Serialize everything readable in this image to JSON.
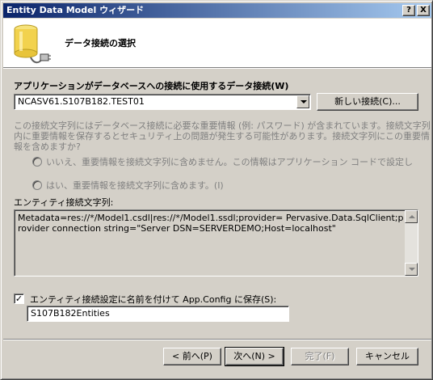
{
  "window": {
    "title": "Entity Data Model ウィザード",
    "help_btn": "?",
    "close_btn": "X"
  },
  "header": {
    "title": "データ接続の選択",
    "icon": "database-connection-icon"
  },
  "connection": {
    "label": "アプリケーションがデータベースへの接続に使用するデータ接続(W)",
    "selected": "NCASV61.S107B182.TEST01",
    "new_button": "新しい接続(C)..."
  },
  "sensitive": {
    "description_line1": "この接続文字列にはデータベース接続に必要な重要情報 (例: パスワード) が含まれています。接続文字列",
    "description_line2": "内に重要情報を保存するとセキュリティ上の問題が発生する可能性があります。接続文字列にこの重要情",
    "description_line3": "報を含めますか?",
    "option_no": "いいえ、重要情報を接続文字列に含めません。この情報はアプリケーション コードで設定し",
    "option_yes": "はい、重要情報を接続文字列に含めます。(I)"
  },
  "entity_conn": {
    "label": "エンティティ接続文字列:",
    "value": "Metadata=res://*/Model1.csdl|res://*/Model1.ssdl;provider= Pervasive.Data.SqlClient;provider connection string=\"Server DSN=SERVERDEMO;Host=localhost\""
  },
  "save_config": {
    "checked": true,
    "check_mark": "✓",
    "label": "エンティティ接続設定に名前を付けて App.Config に保存(S):",
    "value": "S107B182Entities"
  },
  "footer": {
    "back": "< 前へ(P)",
    "next": "次へ(N) >",
    "finish": "完了(F)",
    "cancel": "キャンセル"
  }
}
